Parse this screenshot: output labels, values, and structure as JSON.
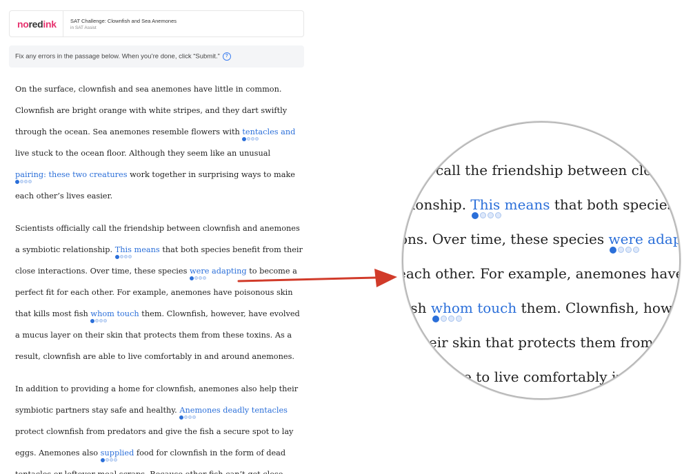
{
  "header": {
    "logo": {
      "no": "no",
      "red": "red",
      "ink": "ink"
    },
    "title": "SAT Challenge: Clownfish and Sea Anemones",
    "subtitle": "in SAT Assist"
  },
  "instructions": {
    "text": "Fix any errors in the passage below. When you’re done, click “Submit.”",
    "help_icon": "?"
  },
  "passage": {
    "p1": {
      "l1": "On the surface, clownfish and sea anemones have little in common.",
      "l2": "Clownfish are bright orange with white stripes, and they dart swiftly",
      "l3a": "through the ocean. Sea anemones resemble flowers with ",
      "l3h": "tentacles and",
      "l4": "live stuck to the ocean floor. Although they seem like an unusual",
      "l5h": "pairing: these two creatures",
      "l5b": " work together in surprising ways to make",
      "l6": "each other’s lives easier."
    },
    "p2": {
      "l1": "Scientists officially call the friendship between clownfish and anemones",
      "l2a": "a symbiotic relationship. ",
      "l2h": "This means",
      "l2b": " that both species benefit from their",
      "l3a": "close interactions. Over time, these species ",
      "l3h": "were adapting",
      "l3b": " to become a",
      "l4": "perfect fit for each other. For example, anemones have poisonous skin",
      "l5a": "that kills most fish ",
      "l5h": "whom touch",
      "l5b": " them. Clownfish, however, have evolved",
      "l6": "a mucus layer on their skin that protects them from these toxins. As a",
      "l7": "result, clownfish are able to live comfortably in and around anemones."
    },
    "p3": {
      "l1": "In addition to providing a home for clownfish, anemones also help their",
      "l2a": "symbiotic partners stay safe and healthy. ",
      "l2h": "Anemones deadly tentacles",
      "l3": "protect clownfish from predators and give the fish a secure spot to lay",
      "l4a": "eggs. Anemones also ",
      "l4h": "supplied",
      "l4b": " food for clownfish in the form of dead",
      "l5": "tentacles or leftover meal scraps. Because other fish can’t get close"
    }
  },
  "magnifier": {
    "m1": "call the friendship between clown",
    "m2a": "tionship. ",
    "m2h": "This means",
    "m2b": " that both species b",
    "m3a": "ons. Over time, these species ",
    "m3h": "were adapting",
    "m4": "each other. For example, anemones have po",
    "m5a": "fish ",
    "m5h": "whom touch",
    "m5b": " them. Clownfish, howeve",
    "m6": "heir skin that protects them from th",
    "m7a": "e to live comfortably in a"
  },
  "colors": {
    "accent": "#2b6fd9",
    "logo_pink": "#e7336f",
    "arrow": "#d13b2a"
  }
}
